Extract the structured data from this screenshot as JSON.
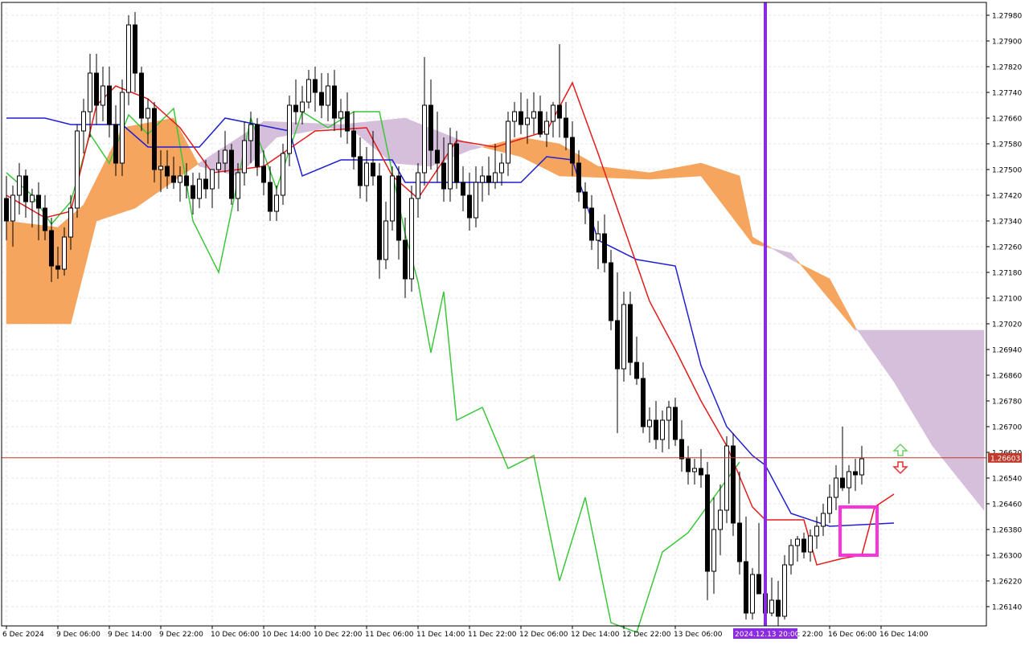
{
  "chart_data": {
    "type": "candlestick",
    "instrument_note": "",
    "y_axis": {
      "min": 1.2608,
      "max": 1.2802,
      "tick_labels": [
        "1.27980",
        "1.27900",
        "1.27820",
        "1.27740",
        "1.27660",
        "1.27580",
        "1.27500",
        "1.27420",
        "1.27340",
        "1.27260",
        "1.27180",
        "1.27100",
        "1.27020",
        "1.26940",
        "1.26860",
        "1.26780",
        "1.26700",
        "1.26620",
        "1.26540",
        "1.26460",
        "1.26380",
        "1.26300",
        "1.26220",
        "1.26140"
      ],
      "tick_values": [
        1.2798,
        1.279,
        1.2782,
        1.2774,
        1.2766,
        1.2758,
        1.275,
        1.2742,
        1.2734,
        1.2726,
        1.2718,
        1.271,
        1.2702,
        1.2694,
        1.2686,
        1.2678,
        1.267,
        1.2662,
        1.2654,
        1.2646,
        1.2638,
        1.263,
        1.2622,
        1.2614
      ]
    },
    "x_axis": {
      "labels": [
        {
          "text": "6 Dec 2024",
          "bar": 0
        },
        {
          "text": "9 Dec 06:00",
          "bar": 8
        },
        {
          "text": "9 Dec 14:00",
          "bar": 16
        },
        {
          "text": "9 Dec 22:00",
          "bar": 24
        },
        {
          "text": "10 Dec 06:00",
          "bar": 32
        },
        {
          "text": "10 Dec 14:00",
          "bar": 40
        },
        {
          "text": "10 Dec 22:00",
          "bar": 48
        },
        {
          "text": "11 Dec 06:00",
          "bar": 56
        },
        {
          "text": "11 Dec 14:00",
          "bar": 64
        },
        {
          "text": "11 Dec 22:00",
          "bar": 72
        },
        {
          "text": "12 Dec 06:00",
          "bar": 80
        },
        {
          "text": "12 Dec 14:00",
          "bar": 88
        },
        {
          "text": "12 Dec 22:00",
          "bar": 96
        },
        {
          "text": "13 Dec 06:00",
          "bar": 104
        },
        {
          "text": "16 Dec 06:00",
          "bar": 128
        },
        {
          "text": "16 Dec 14:00",
          "bar": 136
        }
      ],
      "partial_label": "c 22:00",
      "highlight_label": "2024.12.13 20:00"
    },
    "current_price": "1.26603",
    "current_price_value": 1.26603,
    "vertical_marker_bar": 118,
    "candles": [
      [
        1.2741,
        1.2748,
        1.2728,
        1.2734
      ],
      [
        1.2734,
        1.2745,
        1.2726,
        1.2742
      ],
      [
        1.2742,
        1.2752,
        1.2736,
        1.2748
      ],
      [
        1.2748,
        1.275,
        1.2735,
        1.274
      ],
      [
        1.274,
        1.2744,
        1.2732,
        1.2742
      ],
      [
        1.2742,
        1.2746,
        1.2728,
        1.2738
      ],
      [
        1.2738,
        1.2742,
        1.2728,
        1.2731
      ],
      [
        1.2731,
        1.2735,
        1.2715,
        1.272
      ],
      [
        1.272,
        1.2726,
        1.2716,
        1.2719
      ],
      [
        1.2719,
        1.2732,
        1.2717,
        1.2729
      ],
      [
        1.2729,
        1.2742,
        1.2725,
        1.2738
      ],
      [
        1.2738,
        1.2764,
        1.2735,
        1.2762
      ],
      [
        1.2762,
        1.2772,
        1.2755,
        1.2768
      ],
      [
        1.2768,
        1.2786,
        1.276,
        1.278
      ],
      [
        1.278,
        1.2786,
        1.2764,
        1.277
      ],
      [
        1.277,
        1.2782,
        1.2765,
        1.2776
      ],
      [
        1.2776,
        1.2782,
        1.276,
        1.2764
      ],
      [
        1.2764,
        1.277,
        1.2748,
        1.2752
      ],
      [
        1.2752,
        1.2778,
        1.2748,
        1.2774
      ],
      [
        1.2774,
        1.2798,
        1.277,
        1.2795
      ],
      [
        1.2795,
        1.2799,
        1.2774,
        1.278
      ],
      [
        1.278,
        1.2782,
        1.2762,
        1.2766
      ],
      [
        1.2766,
        1.2772,
        1.2758,
        1.2769
      ],
      [
        1.2769,
        1.2771,
        1.2746,
        1.275
      ],
      [
        1.275,
        1.2756,
        1.2743,
        1.2751
      ],
      [
        1.2751,
        1.2756,
        1.2744,
        1.2748
      ],
      [
        1.2748,
        1.2754,
        1.2744,
        1.2746
      ],
      [
        1.2746,
        1.2751,
        1.274,
        1.2748
      ],
      [
        1.2748,
        1.2752,
        1.2741,
        1.2745
      ],
      [
        1.2745,
        1.2749,
        1.2736,
        1.2741
      ],
      [
        1.2741,
        1.2749,
        1.2738,
        1.2747
      ],
      [
        1.2747,
        1.2753,
        1.2741,
        1.2744
      ],
      [
        1.2744,
        1.275,
        1.2738,
        1.275
      ],
      [
        1.275,
        1.2756,
        1.2744,
        1.2752
      ],
      [
        1.2752,
        1.2762,
        1.2749,
        1.2756
      ],
      [
        1.2756,
        1.2758,
        1.2739,
        1.2741
      ],
      [
        1.2741,
        1.2752,
        1.2737,
        1.2749
      ],
      [
        1.2749,
        1.2765,
        1.2745,
        1.2759
      ],
      [
        1.2759,
        1.2768,
        1.2752,
        1.2764
      ],
      [
        1.2764,
        1.2766,
        1.2748,
        1.2751
      ],
      [
        1.2751,
        1.2756,
        1.2742,
        1.2746
      ],
      [
        1.2746,
        1.2751,
        1.2734,
        1.2737
      ],
      [
        1.2737,
        1.2745,
        1.2734,
        1.2742
      ],
      [
        1.2742,
        1.2758,
        1.2739,
        1.2755
      ],
      [
        1.2755,
        1.2773,
        1.2751,
        1.277
      ],
      [
        1.277,
        1.2778,
        1.2764,
        1.2768
      ],
      [
        1.2768,
        1.2776,
        1.2764,
        1.2771
      ],
      [
        1.2771,
        1.2781,
        1.2769,
        1.2778
      ],
      [
        1.2778,
        1.2782,
        1.2768,
        1.2774
      ],
      [
        1.2774,
        1.278,
        1.2766,
        1.277
      ],
      [
        1.277,
        1.278,
        1.2765,
        1.2776
      ],
      [
        1.2776,
        1.2781,
        1.2762,
        1.2766
      ],
      [
        1.2766,
        1.2772,
        1.276,
        1.2768
      ],
      [
        1.2768,
        1.2774,
        1.2758,
        1.2762
      ],
      [
        1.2762,
        1.2768,
        1.275,
        1.2754
      ],
      [
        1.2754,
        1.276,
        1.2741,
        1.2745
      ],
      [
        1.2745,
        1.2757,
        1.274,
        1.2752
      ],
      [
        1.2752,
        1.2762,
        1.2745,
        1.2748
      ],
      [
        1.2748,
        1.2752,
        1.2716,
        1.2722
      ],
      [
        1.2722,
        1.274,
        1.2719,
        1.2734
      ],
      [
        1.2734,
        1.2751,
        1.2731,
        1.2748
      ],
      [
        1.2748,
        1.2751,
        1.2722,
        1.2728
      ],
      [
        1.2728,
        1.2735,
        1.271,
        1.2716
      ],
      [
        1.2716,
        1.2745,
        1.2712,
        1.2741
      ],
      [
        1.2741,
        1.2752,
        1.2735,
        1.2749
      ],
      [
        1.2749,
        1.2785,
        1.2745,
        1.277
      ],
      [
        1.277,
        1.2778,
        1.275,
        1.2756
      ],
      [
        1.2756,
        1.2768,
        1.2746,
        1.2752
      ],
      [
        1.2752,
        1.276,
        1.274,
        1.2744
      ],
      [
        1.2744,
        1.2763,
        1.274,
        1.2758
      ],
      [
        1.2758,
        1.2762,
        1.2744,
        1.2746
      ],
      [
        1.2746,
        1.2751,
        1.2737,
        1.2742
      ],
      [
        1.2742,
        1.2749,
        1.2731,
        1.2735
      ],
      [
        1.2735,
        1.2751,
        1.2732,
        1.2746
      ],
      [
        1.2746,
        1.2751,
        1.274,
        1.2748
      ],
      [
        1.2748,
        1.2754,
        1.2742,
        1.2746
      ],
      [
        1.2746,
        1.2758,
        1.2744,
        1.2749
      ],
      [
        1.2749,
        1.2755,
        1.2745,
        1.2752
      ],
      [
        1.2752,
        1.2768,
        1.2748,
        1.2765
      ],
      [
        1.2765,
        1.2771,
        1.276,
        1.2768
      ],
      [
        1.2768,
        1.2774,
        1.2761,
        1.2764
      ],
      [
        1.2764,
        1.2772,
        1.2758,
        1.2766
      ],
      [
        1.2766,
        1.2774,
        1.2761,
        1.2768
      ],
      [
        1.2768,
        1.2773,
        1.276,
        1.2761
      ],
      [
        1.2761,
        1.2768,
        1.2757,
        1.2765
      ],
      [
        1.2765,
        1.2771,
        1.276,
        1.277
      ],
      [
        1.277,
        1.2789,
        1.276,
        1.2766
      ],
      [
        1.2766,
        1.2771,
        1.2756,
        1.276
      ],
      [
        1.276,
        1.2765,
        1.2748,
        1.2752
      ],
      [
        1.2752,
        1.2756,
        1.274,
        1.2743
      ],
      [
        1.2743,
        1.2746,
        1.2733,
        1.2738
      ],
      [
        1.2738,
        1.2742,
        1.2725,
        1.2728
      ],
      [
        1.2728,
        1.2734,
        1.2719,
        1.273
      ],
      [
        1.273,
        1.2736,
        1.2718,
        1.2721
      ],
      [
        1.2721,
        1.2725,
        1.27,
        1.2703
      ],
      [
        1.2703,
        1.2718,
        1.2668,
        1.2688
      ],
      [
        1.2688,
        1.2712,
        1.2684,
        1.2708
      ],
      [
        1.2708,
        1.2712,
        1.2686,
        1.269
      ],
      [
        1.269,
        1.2698,
        1.2683,
        1.2685
      ],
      [
        1.2685,
        1.269,
        1.2668,
        1.267
      ],
      [
        1.267,
        1.2676,
        1.2665,
        1.2672
      ],
      [
        1.2672,
        1.2678,
        1.2663,
        1.2666
      ],
      [
        1.2666,
        1.2675,
        1.2662,
        1.2672
      ],
      [
        1.2672,
        1.2678,
        1.2663,
        1.2676
      ],
      [
        1.2676,
        1.2679,
        1.2664,
        1.2666
      ],
      [
        1.2666,
        1.2672,
        1.2656,
        1.266
      ],
      [
        1.266,
        1.2664,
        1.2652,
        1.2656
      ],
      [
        1.2656,
        1.266,
        1.2652,
        1.2657
      ],
      [
        1.2657,
        1.2663,
        1.2651,
        1.2655
      ],
      [
        1.2655,
        1.2659,
        1.2616,
        1.2625
      ],
      [
        1.2625,
        1.2648,
        1.2618,
        1.2638
      ],
      [
        1.2638,
        1.2652,
        1.263,
        1.2644
      ],
      [
        1.2644,
        1.2667,
        1.264,
        1.2664
      ],
      [
        1.2664,
        1.2668,
        1.2636,
        1.264
      ],
      [
        1.264,
        1.2656,
        1.2624,
        1.2628
      ],
      [
        1.2628,
        1.2642,
        1.261,
        1.2612
      ],
      [
        1.2612,
        1.2626,
        1.261,
        1.2624
      ],
      [
        1.2624,
        1.264,
        1.262,
        1.2618
      ],
      [
        1.2618,
        1.2624,
        1.261,
        1.2612
      ],
      [
        1.2612,
        1.2623,
        1.2611,
        1.2616
      ],
      [
        1.2616,
        1.2622,
        1.2608,
        1.2611
      ],
      [
        1.2611,
        1.263,
        1.261,
        1.2627
      ],
      [
        1.2627,
        1.2635,
        1.2624,
        1.2633
      ],
      [
        1.2633,
        1.2636,
        1.2628,
        1.2635
      ],
      [
        1.2635,
        1.2637,
        1.2629,
        1.2631
      ],
      [
        1.2631,
        1.2638,
        1.2628,
        1.2636
      ],
      [
        1.2636,
        1.2642,
        1.2632,
        1.2639
      ],
      [
        1.2639,
        1.2646,
        1.2636,
        1.2643
      ],
      [
        1.2643,
        1.2652,
        1.264,
        1.2648
      ],
      [
        1.2648,
        1.2658,
        1.2644,
        1.2654
      ],
      [
        1.2654,
        1.267,
        1.265,
        1.2651
      ],
      [
        1.2651,
        1.2658,
        1.2646,
        1.2656
      ],
      [
        1.2656,
        1.266,
        1.265,
        1.2655
      ],
      [
        1.2655,
        1.2664,
        1.2652,
        1.266
      ]
    ],
    "tenkan_sen": [
      [
        0,
        1.2742
      ],
      [
        6,
        1.2735
      ],
      [
        10,
        1.2737
      ],
      [
        14,
        1.277
      ],
      [
        17,
        1.2776
      ],
      [
        22,
        1.2772
      ],
      [
        27,
        1.2763
      ],
      [
        32,
        1.2749
      ],
      [
        40,
        1.2751
      ],
      [
        48,
        1.2762
      ],
      [
        56,
        1.2763
      ],
      [
        60,
        1.2748
      ],
      [
        64,
        1.2741
      ],
      [
        70,
        1.2759
      ],
      [
        76,
        1.2757
      ],
      [
        84,
        1.2762
      ],
      [
        88,
        1.2777
      ],
      [
        92,
        1.2755
      ],
      [
        96,
        1.2732
      ],
      [
        100,
        1.2709
      ],
      [
        104,
        1.2694
      ],
      [
        108,
        1.2678
      ],
      [
        112,
        1.2664
      ],
      [
        116,
        1.2645
      ],
      [
        118,
        1.2641
      ],
      [
        124,
        1.2641
      ],
      [
        126,
        1.2627
      ],
      [
        130,
        1.2629
      ],
      [
        133,
        1.263
      ],
      [
        135,
        1.2645
      ],
      [
        138,
        1.2649
      ]
    ],
    "kijun_sen": [
      [
        0,
        1.2766
      ],
      [
        6,
        1.2766
      ],
      [
        10,
        1.2764
      ],
      [
        18,
        1.2764
      ],
      [
        22,
        1.2757
      ],
      [
        30,
        1.2757
      ],
      [
        34,
        1.2766
      ],
      [
        44,
        1.2762
      ],
      [
        46,
        1.2748
      ],
      [
        52,
        1.2753
      ],
      [
        60,
        1.2753
      ],
      [
        62,
        1.2746
      ],
      [
        80,
        1.2746
      ],
      [
        84,
        1.2754
      ],
      [
        88,
        1.2753
      ],
      [
        92,
        1.2728
      ],
      [
        98,
        1.2722
      ],
      [
        104,
        1.272
      ],
      [
        108,
        1.2689
      ],
      [
        112,
        1.267
      ],
      [
        116,
        1.2661
      ],
      [
        118,
        1.2658
      ],
      [
        122,
        1.2643
      ],
      [
        128,
        1.2639
      ],
      [
        138,
        1.264
      ]
    ],
    "chikou_span": [
      [
        0,
        1.2749
      ],
      [
        4,
        1.2742
      ],
      [
        7,
        1.2733
      ],
      [
        10,
        1.274
      ],
      [
        13,
        1.2761
      ],
      [
        16,
        1.2752
      ],
      [
        19,
        1.2767
      ],
      [
        22,
        1.2761
      ],
      [
        26,
        1.2769
      ],
      [
        29,
        1.2734
      ],
      [
        33,
        1.2718
      ],
      [
        38,
        1.2766
      ],
      [
        42,
        1.2744
      ],
      [
        46,
        1.2768
      ],
      [
        50,
        1.2763
      ],
      [
        54,
        1.2768
      ],
      [
        58,
        1.2768
      ],
      [
        62,
        1.273
      ],
      [
        64,
        1.2715
      ],
      [
        66,
        1.2693
      ],
      [
        68,
        1.2712
      ],
      [
        70,
        1.2672
      ],
      [
        74,
        1.2676
      ],
      [
        78,
        1.2657
      ],
      [
        82,
        1.2661
      ],
      [
        86,
        1.2622
      ],
      [
        90,
        1.2648
      ],
      [
        94,
        1.2609
      ],
      [
        98,
        1.2606
      ],
      [
        102,
        1.2631
      ],
      [
        106,
        1.2637
      ],
      [
        110,
        1.2648
      ],
      [
        114,
        1.2659
      ]
    ],
    "senkou_span_a": [
      [
        0,
        1.2734
      ],
      [
        8,
        1.2732
      ],
      [
        12,
        1.2739
      ],
      [
        18,
        1.2763
      ],
      [
        26,
        1.2766
      ],
      [
        30,
        1.2751
      ],
      [
        36,
        1.2748
      ],
      [
        42,
        1.276
      ],
      [
        50,
        1.2763
      ],
      [
        54,
        1.2762
      ],
      [
        60,
        1.2752
      ],
      [
        66,
        1.2751
      ],
      [
        72,
        1.2756
      ],
      [
        80,
        1.276
      ],
      [
        86,
        1.2758
      ],
      [
        92,
        1.2751
      ],
      [
        100,
        1.2749
      ],
      [
        108,
        1.2752
      ],
      [
        114,
        1.2748
      ],
      [
        116,
        1.2729
      ],
      [
        122,
        1.2722
      ],
      [
        128,
        1.2716
      ],
      [
        132,
        1.2701
      ],
      [
        138,
        1.2684
      ],
      [
        144,
        1.2664
      ],
      [
        150,
        1.2649
      ],
      [
        152,
        1.2644
      ]
    ],
    "senkou_span_b": [
      [
        0,
        1.2702
      ],
      [
        10,
        1.2702
      ],
      [
        14,
        1.2734
      ],
      [
        20,
        1.2738
      ],
      [
        30,
        1.2752
      ],
      [
        40,
        1.2765
      ],
      [
        52,
        1.2764
      ],
      [
        62,
        1.2766
      ],
      [
        72,
        1.2758
      ],
      [
        80,
        1.2754
      ],
      [
        86,
        1.2748
      ],
      [
        100,
        1.2747
      ],
      [
        108,
        1.2748
      ],
      [
        116,
        1.2727
      ],
      [
        122,
        1.2724
      ],
      [
        132,
        1.27
      ],
      [
        138,
        1.27
      ],
      [
        152,
        1.27
      ]
    ],
    "highlight_box": {
      "bar_from": 130,
      "bar_to": 135,
      "price_from": 1.2631,
      "price_to": 1.2644
    },
    "arrows": [
      {
        "direction": "up",
        "bar": 139,
        "price": 1.26625,
        "color": "#6bd06b"
      },
      {
        "direction": "down",
        "bar": 139,
        "price": 1.26575,
        "color": "#e03030"
      }
    ],
    "colors": {
      "bull_body": "#ffffff",
      "bear_body": "#000000",
      "wick": "#000000",
      "tenkan": "#e31b1b",
      "kijun": "#1f1fd0",
      "chikou": "#3cc63c",
      "kumo_bull": "#f5a55e",
      "kumo_bear": "#d6bfda",
      "vertical_marker": "#8a2be2",
      "current_price_line": "#c0392b",
      "highlight_box": "#ff33dd",
      "axis_label_bg": "#8a2be2"
    }
  }
}
